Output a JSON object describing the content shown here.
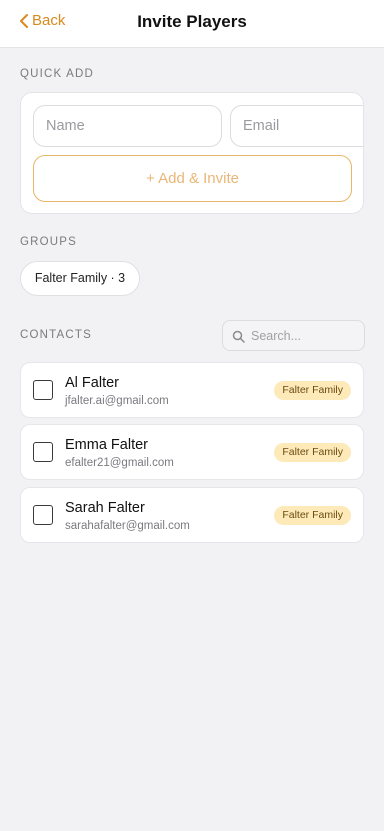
{
  "header": {
    "back_label": "Back",
    "title": "Invite Players"
  },
  "quick_add": {
    "section_label": "QUICK ADD",
    "name_placeholder": "Name",
    "email_placeholder": "Email",
    "add_button_label": "+ Add & Invite"
  },
  "groups": {
    "section_label": "GROUPS",
    "items": [
      {
        "label": "Falter Family · 3"
      }
    ]
  },
  "contacts": {
    "section_label": "CONTACTS",
    "search_placeholder": "Search...",
    "items": [
      {
        "name": "Al Falter",
        "email": "jfalter.ai@gmail.com",
        "group": "Falter Family",
        "checked": false
      },
      {
        "name": "Emma Falter",
        "email": "efalter21@gmail.com",
        "group": "Falter Family",
        "checked": false
      },
      {
        "name": "Sarah Falter",
        "email": "sarahafalter@gmail.com",
        "group": "Falter Family",
        "checked": false
      }
    ]
  },
  "colors": {
    "accent": "#d98a1e",
    "badge_bg": "#fdeab8",
    "background": "#f2f2f4"
  },
  "icons": {
    "back": "chevron-left-icon",
    "search": "search-icon"
  }
}
